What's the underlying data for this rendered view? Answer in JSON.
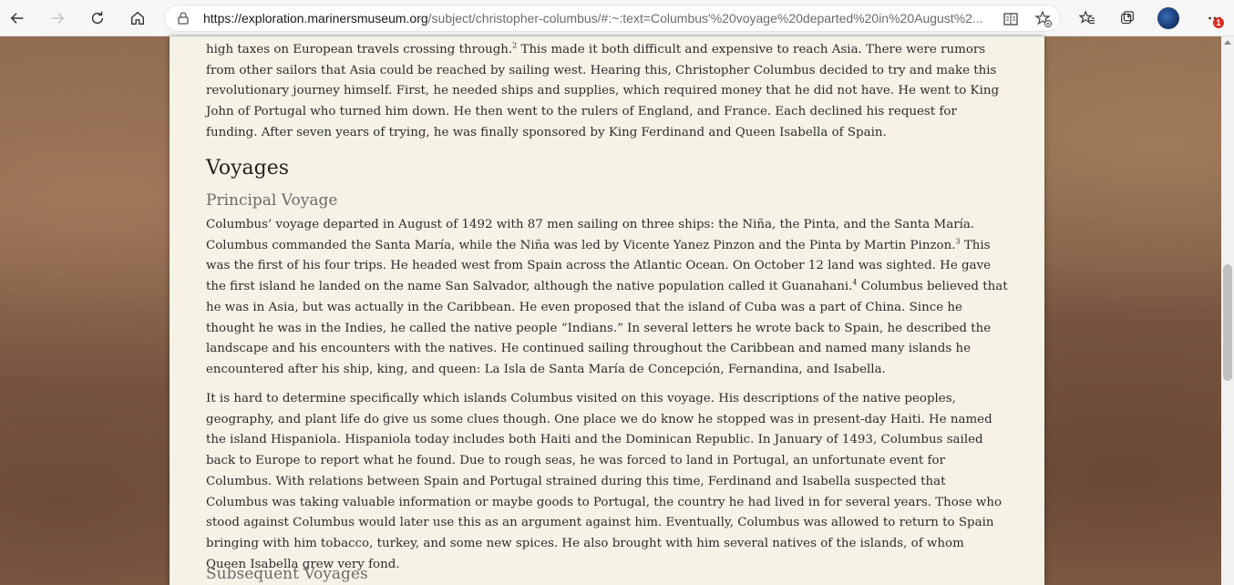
{
  "browser": {
    "url_host": "https://exploration.marinersmuseum.org",
    "url_path": "/subject/christopher-columbus/#:~:text=Columbus'%20voyage%20departed%20in%20August%2...",
    "notification_count": "1",
    "icons": [
      "back-arrow-icon",
      "forward-arrow-icon",
      "refresh-icon",
      "home-icon",
      "lock-icon",
      "reader-view-icon",
      "add-favorite-icon",
      "favorites-icon",
      "collections-icon",
      "profile-avatar",
      "more-icon"
    ]
  },
  "article": {
    "intro_text": "high taxes on European travels crossing through.",
    "intro_sup": "2",
    "intro_rest": " This made it both difficult and expensive to reach Asia. There were rumors from other sailors that Asia could be reached by sailing west. Hearing this, Christopher Columbus decided to try and make this revolutionary journey himself. First, he needed ships and supplies, which required money that he did not have. He went to King John of Portugal who turned him down. He then went to the rulers of England, and France. Each declined his request for funding. After seven years of trying, he was finally sponsored by King Ferdinand and Queen Isabella of Spain.",
    "heading_voyages": "Voyages",
    "heading_principal": "Principal Voyage",
    "p1_a": "Columbus’ voyage departed in August of 1492 with 87 men sailing on three ships: the Niña, the Pinta, and the Santa María. Columbus commanded the Santa María, while the Niña was led by Vicente Yanez Pinzon and the Pinta by Martin Pinzon.",
    "p1_sup1": "3",
    "p1_b": " This was the first of his four trips. He headed west from Spain across the Atlantic Ocean. On October 12 land was sighted. He gave the first island he landed on the name San Salvador, although the native population called it Guanahani.",
    "p1_sup2": "4",
    "p1_c": " Columbus believed that he was in Asia, but was actually in the Caribbean. He even proposed that the island of Cuba was a part of China. Since he thought he was in the Indies, he called the native people “Indians.” In several letters he wrote back to Spain, he described the landscape and his encounters with the natives. He continued sailing throughout the Caribbean and named many islands he encountered after his ship, king, and queen: La Isla de Santa María de Concepción, Fernandina, and Isabella.",
    "p2": "It is hard to determine specifically which islands Columbus visited on this voyage. His descriptions of the native peoples, geography, and plant life do give us some clues though. One place we do know he stopped was in present-day Haiti. He named the island Hispaniola. Hispaniola today includes both Haiti and the Dominican Republic. In January of 1493, Columbus sailed back to Europe to report what he found. Due to rough seas, he was forced to land in Portugal, an unfortunate event for Columbus. With relations between Spain and Portugal strained during this time, Ferdinand and Isabella suspected that Columbus was taking valuable information or maybe goods to Portugal, the country he had lived in for several years. Those who stood against Columbus would later use this as an argument against him. Eventually, Columbus was allowed to return to Spain bringing with him tobacco, turkey, and some new spices. He also brought with him several natives of the islands, of whom Queen Isabella grew very fond.",
    "heading_subsequent": "Subsequent Voyages"
  }
}
